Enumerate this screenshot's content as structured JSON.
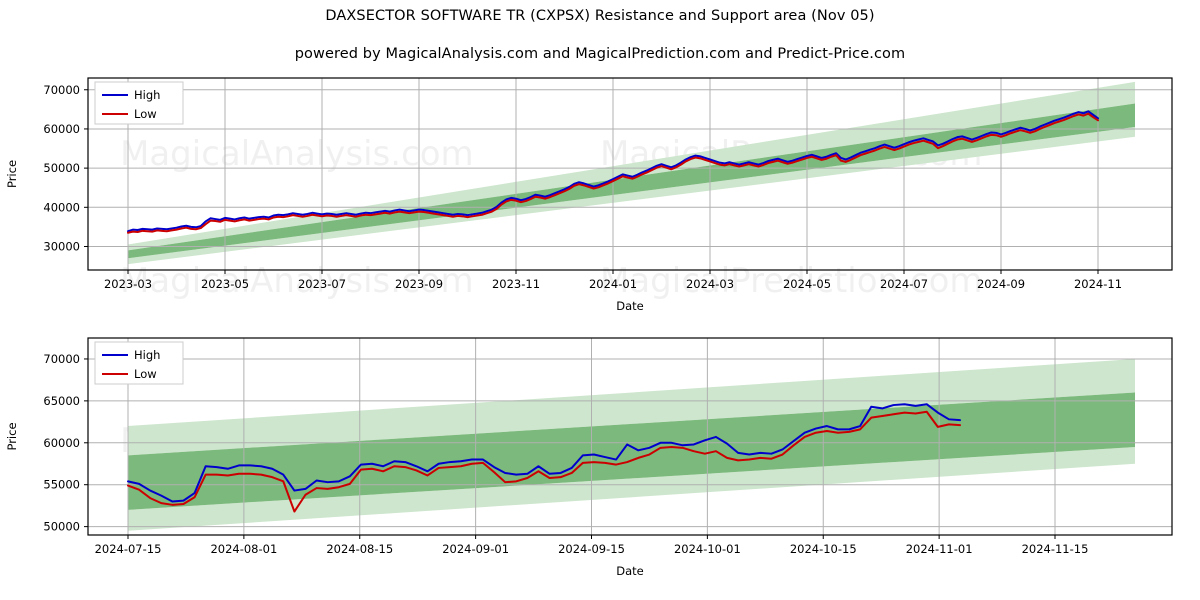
{
  "header": {
    "title": "DAXSECTOR SOFTWARE TR (CXPSX) Resistance and Support area (Nov 05)",
    "subtitle": "powered by MagicalAnalysis.com and MagicalPrediction.com and Predict-Price.com"
  },
  "watermarks": {
    "left": "MagicalAnalysis.com",
    "right": "MagicalPrediction.com"
  },
  "colors": {
    "high": "#0000cc",
    "low": "#cc0000",
    "band_inner": "#7cb97c",
    "band_outer": "#cde6cd",
    "grid": "#b0b0b0",
    "frame": "#000000"
  },
  "chart_data": [
    {
      "type": "line",
      "id": "overview",
      "title": "DAXSECTOR SOFTWARE TR (CXPSX) Resistance and Support area (Nov 05)",
      "xlabel": "Date",
      "ylabel": "Price",
      "ylim": [
        24000,
        73000
      ],
      "yticks": [
        30000,
        40000,
        50000,
        60000,
        70000
      ],
      "ytick_labels": [
        "30000",
        "40000",
        "50000",
        "60000",
        "70000"
      ],
      "xticks": [
        "2023-03",
        "2023-05",
        "2023-07",
        "2023-09",
        "2023-11",
        "2024-01",
        "2024-03",
        "2024-05",
        "2024-07",
        "2024-09",
        "2024-11"
      ],
      "grid": true,
      "legend": [
        "High",
        "Low"
      ],
      "legend_position": "upper left",
      "series": [
        {
          "name": "High",
          "values": [
            33900,
            34300,
            34200,
            34500,
            34400,
            34300,
            34600,
            34500,
            34400,
            34600,
            34800,
            35100,
            35300,
            35000,
            34900,
            35200,
            36400,
            37200,
            37000,
            36800,
            37300,
            37100,
            36900,
            37200,
            37400,
            37100,
            37300,
            37500,
            37600,
            37400,
            37900,
            38100,
            38000,
            38200,
            38500,
            38300,
            38100,
            38300,
            38600,
            38400,
            38200,
            38400,
            38300,
            38100,
            38300,
            38500,
            38300,
            38100,
            38400,
            38600,
            38500,
            38700,
            38900,
            39100,
            38900,
            39200,
            39400,
            39200,
            39000,
            39200,
            39400,
            39300,
            39100,
            38900,
            38700,
            38500,
            38300,
            38100,
            38300,
            38200,
            38000,
            38200,
            38400,
            38600,
            39000,
            39400,
            40100,
            41200,
            42000,
            42400,
            42200,
            41800,
            42100,
            42600,
            43200,
            43000,
            42700,
            43100,
            43600,
            44100,
            44600,
            45200,
            46000,
            46400,
            46100,
            45700,
            45300,
            45600,
            46100,
            46600,
            47200,
            47800,
            48400,
            48100,
            47800,
            48300,
            48900,
            49400,
            50000,
            50600,
            51000,
            50600,
            50200,
            50700,
            51400,
            52200,
            52800,
            53200,
            53000,
            52600,
            52200,
            51800,
            51400,
            51200,
            51500,
            51200,
            50900,
            51200,
            51500,
            51200,
            50900,
            51300,
            51800,
            52100,
            52400,
            52000,
            51600,
            51900,
            52300,
            52700,
            53100,
            53400,
            53000,
            52600,
            52900,
            53400,
            53800,
            52600,
            52200,
            52700,
            53300,
            53900,
            54300,
            54700,
            55100,
            55600,
            56000,
            55600,
            55200,
            55600,
            56100,
            56600,
            57000,
            57300,
            57600,
            57200,
            56800,
            55800,
            56200,
            56800,
            57400,
            57900,
            58100,
            57700,
            57300,
            57700,
            58200,
            58700,
            59100,
            59000,
            58600,
            59000,
            59500,
            59900,
            60300,
            60000,
            59600,
            60000,
            60600,
            61100,
            61600,
            62100,
            62500,
            62900,
            63400,
            63900,
            64300,
            64000,
            64500,
            63600,
            62700
          ]
        },
        {
          "name": "Low",
          "values": [
            33500,
            33800,
            33700,
            34000,
            33900,
            33800,
            34100,
            34000,
            33900,
            34100,
            34300,
            34600,
            34800,
            34500,
            34400,
            34700,
            35700,
            36600,
            36500,
            36300,
            36800,
            36600,
            36400,
            36700,
            36900,
            36600,
            36800,
            37000,
            37100,
            36900,
            37400,
            37600,
            37500,
            37700,
            38000,
            37800,
            37600,
            37800,
            38100,
            37900,
            37700,
            37900,
            37800,
            37600,
            37800,
            38000,
            37800,
            37600,
            37900,
            38100,
            38000,
            38200,
            38400,
            38600,
            38400,
            38700,
            38900,
            38700,
            38500,
            38700,
            38900,
            38800,
            38600,
            38400,
            38200,
            38000,
            37800,
            37600,
            37800,
            37700,
            37500,
            37700,
            37900,
            38100,
            38500,
            38900,
            39600,
            40700,
            41500,
            41900,
            41700,
            41300,
            41600,
            42100,
            42700,
            42500,
            42200,
            42600,
            43100,
            43600,
            44100,
            44700,
            45500,
            45900,
            45600,
            45200,
            44800,
            45100,
            45600,
            46100,
            46700,
            47300,
            47900,
            47600,
            47300,
            47800,
            48400,
            48900,
            49500,
            50100,
            50500,
            50100,
            49700,
            50200,
            50900,
            51700,
            52300,
            52700,
            52500,
            52100,
            51700,
            51300,
            50900,
            50700,
            51000,
            50700,
            50400,
            50700,
            51000,
            50700,
            50400,
            50800,
            51300,
            51600,
            51900,
            51500,
            51100,
            51400,
            51800,
            52200,
            52600,
            52900,
            52500,
            52100,
            52400,
            52900,
            53300,
            51900,
            51600,
            52100,
            52700,
            53300,
            53700,
            54100,
            54500,
            55000,
            55400,
            55000,
            54600,
            55000,
            55500,
            56000,
            56400,
            56700,
            57000,
            56600,
            56200,
            55100,
            55600,
            56200,
            56800,
            57300,
            57500,
            57100,
            56700,
            57100,
            57600,
            58100,
            58500,
            58400,
            58000,
            58400,
            58900,
            59300,
            59700,
            59400,
            59000,
            59400,
            60000,
            60500,
            61000,
            61500,
            61900,
            62300,
            62800,
            63300,
            63700,
            63400,
            63900,
            63000,
            62200
          ]
        }
      ],
      "bands": {
        "description": "Resistance and support wedge widening to the right",
        "outer_upper": {
          "start": 30500,
          "end": 72000
        },
        "inner_upper": {
          "start": 29000,
          "end": 66500
        },
        "inner_lower": {
          "start": 27000,
          "end": 60500
        },
        "outer_lower": {
          "start": 25500,
          "end": 58000
        }
      }
    },
    {
      "type": "line",
      "id": "zoom",
      "xlabel": "Date",
      "ylabel": "Price",
      "ylim": [
        49000,
        72500
      ],
      "yticks": [
        50000,
        55000,
        60000,
        65000,
        70000
      ],
      "ytick_labels": [
        "50000",
        "55000",
        "60000",
        "65000",
        "70000"
      ],
      "xticks": [
        "2024-07-15",
        "2024-08-01",
        "2024-08-15",
        "2024-09-01",
        "2024-09-15",
        "2024-10-01",
        "2024-10-15",
        "2024-11-01",
        "2024-11-15"
      ],
      "grid": true,
      "legend": [
        "High",
        "Low"
      ],
      "legend_position": "upper left",
      "series": [
        {
          "name": "High",
          "values": [
            55400,
            55100,
            54300,
            53700,
            53000,
            53100,
            54000,
            57200,
            57100,
            56900,
            57300,
            57300,
            57200,
            56900,
            56200,
            54300,
            54500,
            55500,
            55300,
            55400,
            56000,
            57400,
            57500,
            57200,
            57800,
            57700,
            57200,
            56600,
            57500,
            57700,
            57800,
            58000,
            58000,
            57100,
            56400,
            56200,
            56300,
            57200,
            56300,
            56400,
            57000,
            58500,
            58600,
            58300,
            58000,
            59800,
            59100,
            59400,
            60000,
            60000,
            59700,
            59800,
            60300,
            60700,
            59900,
            58800,
            58600,
            58800,
            58700,
            59200,
            60200,
            61200,
            61700,
            62000,
            61600,
            61600,
            62000,
            64300,
            64100,
            64500,
            64600,
            64400,
            64600,
            63600,
            62800,
            62700
          ]
        },
        {
          "name": "Low",
          "values": [
            54900,
            54400,
            53400,
            52800,
            52600,
            52700,
            53500,
            56200,
            56200,
            56100,
            56300,
            56300,
            56200,
            55900,
            55400,
            51800,
            53800,
            54600,
            54500,
            54700,
            55100,
            56800,
            56900,
            56600,
            57200,
            57100,
            56700,
            56100,
            57000,
            57100,
            57200,
            57500,
            57600,
            56500,
            55300,
            55400,
            55800,
            56600,
            55800,
            55900,
            56400,
            57600,
            57700,
            57600,
            57400,
            57700,
            58200,
            58600,
            59400,
            59500,
            59400,
            59000,
            58700,
            59000,
            58200,
            57900,
            58000,
            58200,
            58100,
            58600,
            59700,
            60700,
            61200,
            61400,
            61200,
            61300,
            61600,
            63000,
            63200,
            63400,
            63600,
            63500,
            63700,
            61900,
            62200,
            62100
          ]
        }
      ],
      "bands": {
        "description": "Parallel resistance and support channel",
        "outer_upper": {
          "start": 62000,
          "end": 70000
        },
        "inner_upper": {
          "start": 58500,
          "end": 66000
        },
        "inner_lower": {
          "start": 52000,
          "end": 59500
        },
        "outer_lower": {
          "start": 49500,
          "end": 57500
        }
      }
    }
  ]
}
